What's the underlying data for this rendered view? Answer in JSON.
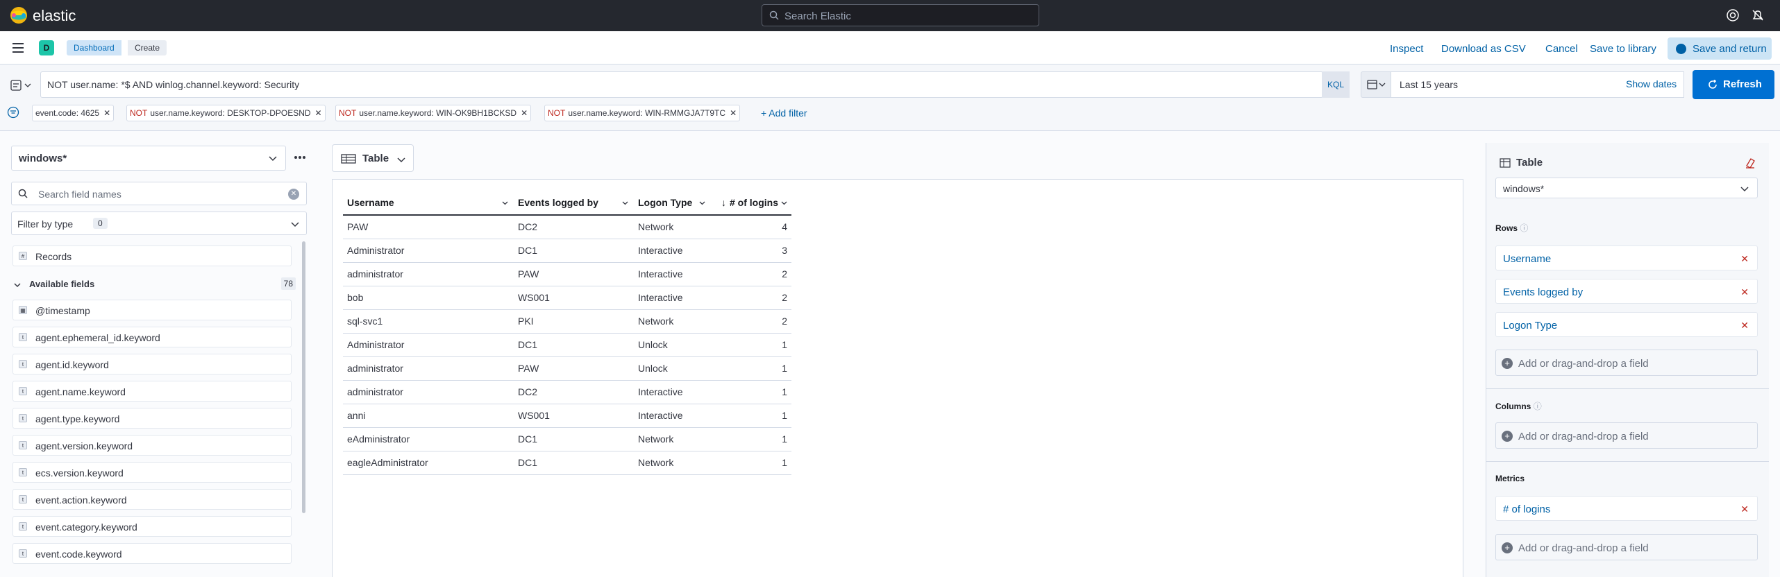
{
  "header": {
    "brand": "elastic",
    "search_placeholder": "Search Elastic"
  },
  "appbar": {
    "space_initial": "D",
    "breadcrumbs": [
      "Dashboard",
      "Create"
    ],
    "actions": {
      "inspect": "Inspect",
      "download": "Download as CSV",
      "cancel": "Cancel",
      "save_library": "Save to library",
      "save_return": "Save and return"
    }
  },
  "query": {
    "text": "NOT user.name: *$ AND winlog.channel.keyword: Security",
    "language": "KQL",
    "date_range": "Last 15 years",
    "show_dates": "Show dates",
    "refresh": "Refresh"
  },
  "filters": [
    {
      "neg": "",
      "text": "event.code: 4625"
    },
    {
      "neg": "NOT",
      "text": "user.name.keyword: DESKTOP-DPOESND"
    },
    {
      "neg": "NOT",
      "text": "user.name.keyword: WIN-OK9BH1BCKSD"
    },
    {
      "neg": "NOT",
      "text": "user.name.keyword: WIN-RMMGJA7T9TC"
    }
  ],
  "add_filter": "+ Add filter",
  "left_panel": {
    "index_pattern": "windows*",
    "search_placeholder": "Search field names",
    "filter_by_type": "Filter by type",
    "filter_count": "0",
    "records": "Records",
    "available_label": "Available fields",
    "available_count": "78",
    "fields": [
      {
        "type": "date",
        "name": "@timestamp"
      },
      {
        "type": "t",
        "name": "agent.ephemeral_id.keyword"
      },
      {
        "type": "t",
        "name": "agent.id.keyword"
      },
      {
        "type": "t",
        "name": "agent.name.keyword"
      },
      {
        "type": "t",
        "name": "agent.type.keyword"
      },
      {
        "type": "t",
        "name": "agent.version.keyword"
      },
      {
        "type": "t",
        "name": "ecs.version.keyword"
      },
      {
        "type": "t",
        "name": "event.action.keyword"
      },
      {
        "type": "t",
        "name": "event.category.keyword"
      },
      {
        "type": "t",
        "name": "event.code.keyword"
      }
    ]
  },
  "viz": {
    "type_label": "Table",
    "columns": [
      "Username",
      "Events logged by",
      "Logon Type",
      "# of logins"
    ],
    "rows": [
      [
        "PAW",
        "DC2",
        "Network",
        "4"
      ],
      [
        "Administrator",
        "DC1",
        "Interactive",
        "3"
      ],
      [
        "administrator",
        "PAW",
        "Interactive",
        "2"
      ],
      [
        "bob",
        "WS001",
        "Interactive",
        "2"
      ],
      [
        "sql-svc1",
        "PKI",
        "Network",
        "2"
      ],
      [
        "Administrator",
        "DC1",
        "Unlock",
        "1"
      ],
      [
        "administrator",
        "PAW",
        "Unlock",
        "1"
      ],
      [
        "administrator",
        "DC2",
        "Interactive",
        "1"
      ],
      [
        "anni",
        "WS001",
        "Interactive",
        "1"
      ],
      [
        "eAdministrator",
        "DC1",
        "Network",
        "1"
      ],
      [
        "eagleAdministrator",
        "DC1",
        "Network",
        "1"
      ]
    ]
  },
  "config": {
    "title": "Table",
    "index": "windows*",
    "rows_label": "Rows",
    "rows": [
      "Username",
      "Events logged by",
      "Logon Type"
    ],
    "columns_label": "Columns",
    "metrics_label": "Metrics",
    "metrics": [
      "# of logins"
    ],
    "add_field": "Add or drag-and-drop a field"
  },
  "colors": {
    "accent": "#0061a6",
    "header_bg": "#25282f",
    "danger": "#bd271e"
  }
}
